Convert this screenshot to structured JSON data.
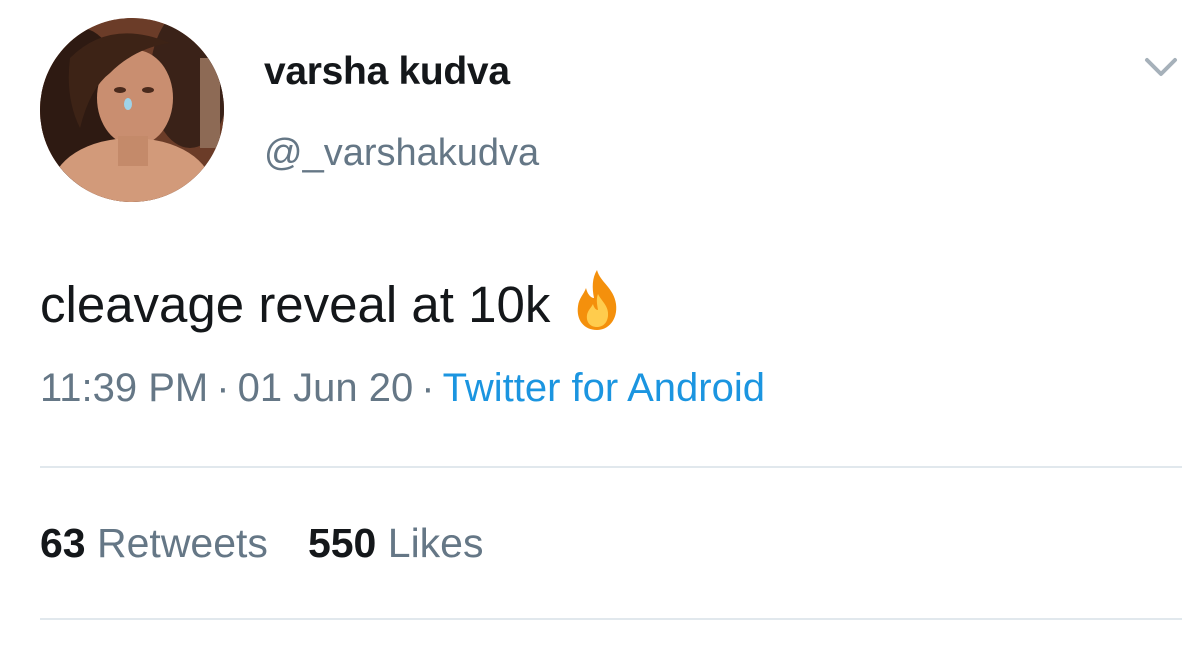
{
  "author": {
    "display_name": "varsha kudva",
    "handle": "@_varshakudva"
  },
  "tweet": {
    "text": "cleavage reveal at 10k",
    "emoji_icon": "fire-icon"
  },
  "meta": {
    "time": "11:39 PM",
    "separator": "·",
    "date": "01 Jun 20",
    "source": "Twitter for Android"
  },
  "stats": {
    "retweets_count": "63",
    "retweets_label": "Retweets",
    "likes_count": "550",
    "likes_label": "Likes"
  },
  "colors": {
    "text_primary": "#14171a",
    "text_secondary": "#657786",
    "link": "#1b95e0",
    "divider": "#e1e8ed"
  },
  "icons": {
    "menu": "chevron-down-icon",
    "emoji": "fire-icon"
  }
}
